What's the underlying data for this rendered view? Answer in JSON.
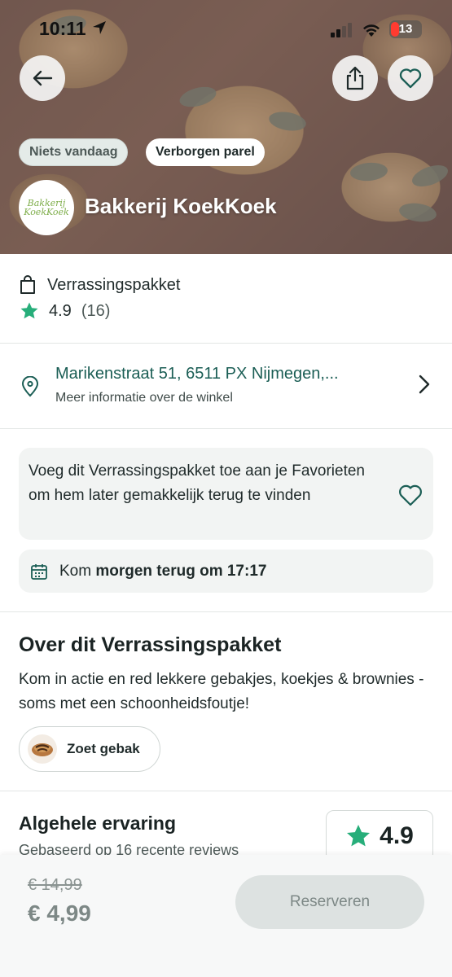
{
  "status_bar": {
    "time": "10:11",
    "battery": "13"
  },
  "hero": {
    "badges": [
      "Niets vandaag",
      "Verborgen parel"
    ],
    "logo_text": "Bakkerij KoekKoek",
    "store_name": "Bakkerij KoekKoek"
  },
  "package": {
    "label": "Verrassingspakket",
    "rating": "4.9",
    "rating_count": "(16)"
  },
  "address": {
    "line": "Marikenstraat 51, 6511 PX Nijmegen,...",
    "subtitle": "Meer informatie over de winkel"
  },
  "favorite_card": {
    "text": "Voeg dit Verrassingspakket toe aan je Favorieten om hem later gemakkelijk terug te vinden"
  },
  "pickup": {
    "prefix": "Kom",
    "bold": "morgen terug om 17:17"
  },
  "about": {
    "title": "Over dit Verrassingspakket",
    "description": "Kom in actie en red lekkere gebakjes, koekjes & brownies - soms met een schoonheidsfoutje!",
    "tag": "Zoet gebak"
  },
  "experience": {
    "title": "Algehele ervaring",
    "subtitle": "Gebaseerd op 16 recente reviews",
    "score": "4.9"
  },
  "bottom_bar": {
    "old_price": "€ 14,99",
    "new_price": "€ 4,99",
    "reserve_label": "Reserveren"
  },
  "colors": {
    "accent_green": "#1b5e55",
    "star_green": "#27ae7a"
  }
}
